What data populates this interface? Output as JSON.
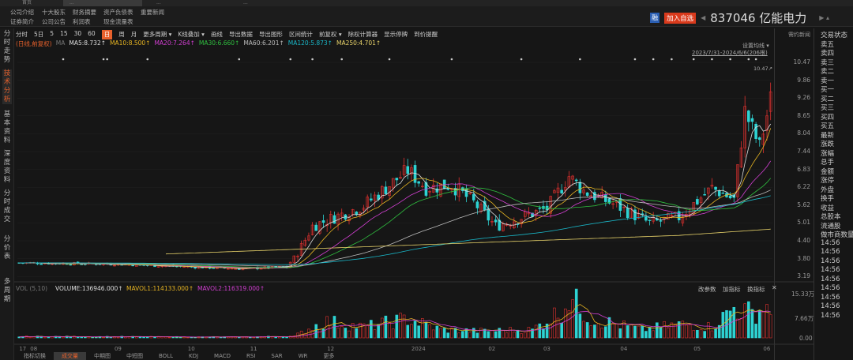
{
  "top_tabs": [
    "首页",
    "...",
    "...",
    "..."
  ],
  "links_row1": [
    "公司介绍",
    "十大股东",
    "财务摘要",
    "资产负债表",
    "重要新闻"
  ],
  "links_row2": [
    "证券简介",
    "公司公告",
    "利润表",
    "现金流量表"
  ],
  "stock": {
    "rong": "融",
    "add_label": "加入自选",
    "title": "837046 亿能电力"
  },
  "side": [
    "分时走势",
    "技术分析",
    "基本资料",
    "深度资料",
    "分时成交",
    "分价表",
    "多周期"
  ],
  "toolbar": [
    "分时",
    "5日",
    "5",
    "15",
    "30",
    "60",
    "日",
    "周",
    "月",
    "更多周期 ▾",
    "K线叠加 ▾",
    "画线",
    "导出数据",
    "导出图形",
    "区间统计",
    "前复权 ▾",
    "除权计算器",
    "显示停牌",
    "到价提醒"
  ],
  "ma_line": {
    "label": "(日线,前复权)",
    "ma": "MA",
    "items": [
      {
        "t": "MA5:8.732↑",
        "c": "#dddddd"
      },
      {
        "t": "MA10:8.500↑",
        "c": "#e6b422"
      },
      {
        "t": "MA20:7.264↑",
        "c": "#d23fd2"
      },
      {
        "t": "MA30:6.660↑",
        "c": "#2fbf3f"
      },
      {
        "t": "MA60:6.201↑",
        "c": "#bbbbbb"
      },
      {
        "t": "MA120:5.873↑",
        "c": "#19b7c8"
      },
      {
        "t": "MA250:4.701↑",
        "c": "#e8d36a"
      }
    ]
  },
  "chart_controls": {
    "set_ma": "设置均线 ▾",
    "range": "2023/7/31-2024/6/6(206根)",
    "high_label": "10.47↗",
    "contract": "需约新闻"
  },
  "price_axis": [
    "10.47",
    "9.86",
    "9.26",
    "8.65",
    "8.04",
    "7.44",
    "6.83",
    "6.22",
    "5.62",
    "5.01",
    "4.40",
    "3.80",
    "3.19"
  ],
  "vol_line": {
    "label": "VOL (5,10)",
    "volume": "VOLUME:136946.000↑",
    "mavol1": "MAVOL1:114133.000↑",
    "mavol2": "MAVOL2:116319.000↑"
  },
  "vol_controls": [
    "改参数",
    "加指标",
    "换指标",
    "✕"
  ],
  "vol_axis": [
    "15.33万",
    "7.66万",
    "0.00"
  ],
  "right_list": [
    "交易状态",
    "卖五",
    "卖四",
    "卖三",
    "卖二",
    "卖一",
    "买一",
    "买二",
    "买三",
    "买四",
    "买五",
    "最新",
    "涨跌",
    "涨幅",
    "总手",
    "金额",
    "涨停",
    "外盘",
    "换手",
    "收益",
    "总股本",
    "流通股",
    "做市商数量",
    "14:56",
    "14:56",
    "14:56",
    "14:56",
    "14:56",
    "14:56",
    "14:56",
    "14:56",
    "14:56"
  ],
  "bottom_tabs": [
    "指标切换",
    "成交量",
    "中期图",
    "中短图",
    "BOLL",
    "KDJ",
    "MACD",
    "RSI",
    "SAR",
    "WR",
    "更多"
  ],
  "chart_data": {
    "type": "candlestick",
    "days": 206,
    "price_range": [
      3.19,
      10.47
    ],
    "close_keypoints": [
      [
        0,
        3.65
      ],
      [
        27,
        3.6
      ],
      [
        60,
        3.45
      ],
      [
        73,
        3.5
      ],
      [
        77,
        4.2
      ],
      [
        80,
        4.9
      ],
      [
        86,
        5.2
      ],
      [
        94,
        5.6
      ],
      [
        103,
        6.5
      ],
      [
        106,
        6.8
      ],
      [
        111,
        6.2
      ],
      [
        118,
        6.3
      ],
      [
        124,
        5.7
      ],
      [
        130,
        4.9
      ],
      [
        137,
        5.2
      ],
      [
        144,
        5.5
      ],
      [
        150,
        6.6
      ],
      [
        154,
        6.1
      ],
      [
        163,
        5.6
      ],
      [
        172,
        5.0
      ],
      [
        180,
        5.2
      ],
      [
        189,
        6.2
      ],
      [
        195,
        5.8
      ],
      [
        198,
        8.8
      ],
      [
        202,
        7.6
      ],
      [
        205,
        9.2
      ]
    ],
    "volume_keypoints_wan": [
      [
        0,
        0.5
      ],
      [
        30,
        0.4
      ],
      [
        60,
        0.3
      ],
      [
        75,
        0.6
      ],
      [
        80,
        4
      ],
      [
        84,
        6
      ],
      [
        94,
        4
      ],
      [
        106,
        7
      ],
      [
        115,
        3
      ],
      [
        125,
        2.5
      ],
      [
        140,
        3
      ],
      [
        148,
        10
      ],
      [
        150,
        15
      ],
      [
        156,
        7
      ],
      [
        170,
        3
      ],
      [
        180,
        5
      ],
      [
        189,
        4
      ],
      [
        195,
        11
      ],
      [
        200,
        9
      ],
      [
        205,
        12
      ]
    ],
    "volume_range_wan": [
      0,
      15.33
    ],
    "month_labels": [
      [
        0,
        "17"
      ],
      [
        3,
        "08"
      ],
      [
        26,
        "09"
      ],
      [
        46,
        "10"
      ],
      [
        63,
        "11"
      ],
      [
        84,
        "12"
      ],
      [
        107,
        "2024"
      ],
      [
        128,
        "02"
      ],
      [
        143,
        "03"
      ],
      [
        164,
        "04"
      ],
      [
        184,
        "05"
      ],
      [
        203,
        "06"
      ]
    ]
  }
}
